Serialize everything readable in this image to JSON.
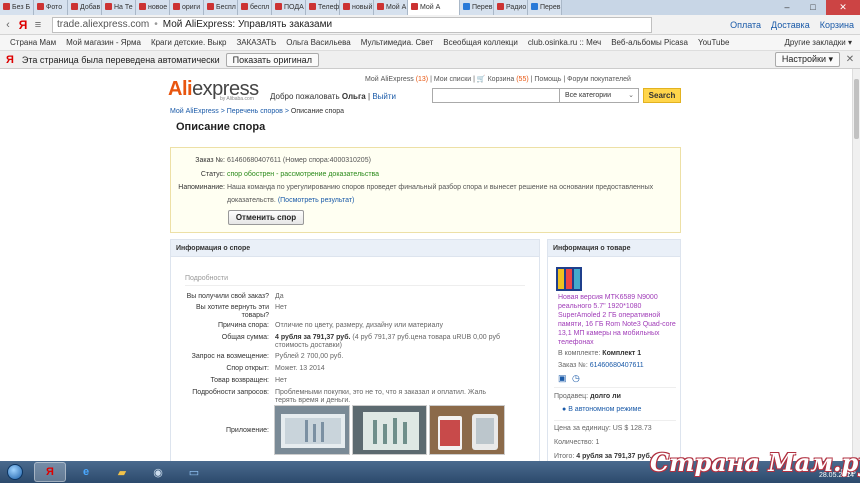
{
  "browser": {
    "tabs": [
      {
        "label": "Без Б",
        "color": "#c33"
      },
      {
        "label": "Фото",
        "color": "#c33"
      },
      {
        "label": "Добав",
        "color": "#c33"
      },
      {
        "label": "На Те",
        "color": "#c33"
      },
      {
        "label": "новое",
        "color": "#c33"
      },
      {
        "label": "ориги",
        "color": "#c33"
      },
      {
        "label": "Беспл",
        "color": "#c33"
      },
      {
        "label": "беспл",
        "color": "#c33"
      },
      {
        "label": "ПОДА",
        "color": "#c33"
      },
      {
        "label": "Телеф",
        "color": "#c33"
      },
      {
        "label": "новый",
        "color": "#c33"
      },
      {
        "label": "Мой А",
        "color": "#c33"
      },
      {
        "label": "Мой А",
        "color": "#c33",
        "active": true
      },
      {
        "label": "Перев",
        "color": "#2a7ad8"
      },
      {
        "label": "Радио",
        "color": "#c33"
      },
      {
        "label": "Перев",
        "color": "#2a7ad8"
      }
    ],
    "url_host": "trade.aliexpress.com",
    "url_title": "Мой AliExpress: Управлять заказами",
    "right_links": [
      "Оплата",
      "Доставка",
      "Корзина"
    ],
    "bookmarks": [
      "Страна Мам",
      "Мой магазин - Ярма",
      "Краги детские. Выкр",
      "ЗАКАЗАТЬ",
      "Ольга Васильева",
      "Мультимедиа. Свет",
      "Всеобщая коллекци",
      "club.osinka.ru :: Меч",
      "Веб-альбомы Picasa",
      "YouTube"
    ],
    "bookmarks_right": "Другие закладки ▾",
    "translate_msg": "Эта страница была переведена автоматически",
    "translate_btn": "Показать оригинал",
    "translate_settings": "Настройки ▾"
  },
  "header": {
    "logo_ali": "Ali",
    "logo_express": "express",
    "logo_sub": "by Alibaba.com",
    "welcome": "Добро пожаловать",
    "user": "Ольга",
    "logout": "Выйти",
    "nav_myali": "Мой AliExpress",
    "nav_myali_count": "(13)",
    "nav_lists": "Мои списки",
    "nav_cart": "Корзина",
    "nav_cart_count": "(55)",
    "nav_help": "Помощь",
    "nav_forum": "Форум покупателей",
    "search_placeholder": "",
    "search_category": "Все категории",
    "search_btn": "Search"
  },
  "breadcrumb": {
    "part1": "Мой AliExpress",
    "part2": "Перечень споров",
    "current": "Описание спора"
  },
  "title": "Описание спора",
  "dispute": {
    "order_label": "Заказ №:",
    "order_value": "61460680407611 (Номер спора:4000310205)",
    "status_label": "Статус:",
    "status_value": "спор обострен - рассмотрение доказательства",
    "reminder_label": "Напоминание:",
    "reminder_line1": "Наша команда по урегулированию споров проведет финальный разбор спора и вынесет решение на основании предоставленных",
    "reminder_line2": "доказательств.",
    "reminder_link": "(Посмотреть результат)",
    "cancel_btn": "Отменить спор"
  },
  "info": {
    "head": "Информация о споре",
    "sub": "Подробности",
    "rows": [
      {
        "label": "Вы получили свой заказ?",
        "value": "Да"
      },
      {
        "label": "Вы хотите вернуть эти товары?",
        "value": "Нет"
      },
      {
        "label": "Причина спора:",
        "value": "Отличие по цвету, размеру, дизайну или материалу"
      },
      {
        "label": "Общая сумма:",
        "value_bold": "4 рубля за 791,37 руб.",
        "value": "(4 руб 791,37 руб.цена товара uRUB 0,00 руб стоимость доставки)"
      },
      {
        "label": "Запрос на возмещение:",
        "value": "Рублей 2 700,00 руб."
      },
      {
        "label": "Спор открыт:",
        "value": "Может. 13 2014"
      },
      {
        "label": "Товар возвращен:",
        "value": "Нет"
      },
      {
        "label": "Подробности запросов:",
        "value": "Проблемными покупки, это не то, что я заказал и оплатил. Жаль терять время и деньги."
      },
      {
        "label": "Приложение:",
        "value": ""
      }
    ]
  },
  "product": {
    "head": "Информация о товаре",
    "title": "Новая версия MTK6589 N9000 реального 5.7\" 1920*1080 SuperAmoled 2 ГБ оперативной памяти, 16 ГБ Rom Note3 Quad-core 13,1 МП камеры на мобильных телефонах",
    "kit_label": "В комплекте:",
    "kit_value": "Комплект 1",
    "order_label": "Заказ №:",
    "order_value": "61460680407611",
    "seller_label": "Продавец:",
    "seller_value": "долго ли",
    "offline": "В автономном режиме",
    "price_label": "Цена за единицу:",
    "price_value": "US $ 128.73",
    "qty_label": "Количество:",
    "qty_value": "1",
    "total_label": "Итого:",
    "total_value": "4 рубля за 791,37 руб."
  },
  "taskbar": {
    "lang": "ENG",
    "date": "28.05.2014"
  },
  "watermark": "Страна Мам.ру"
}
